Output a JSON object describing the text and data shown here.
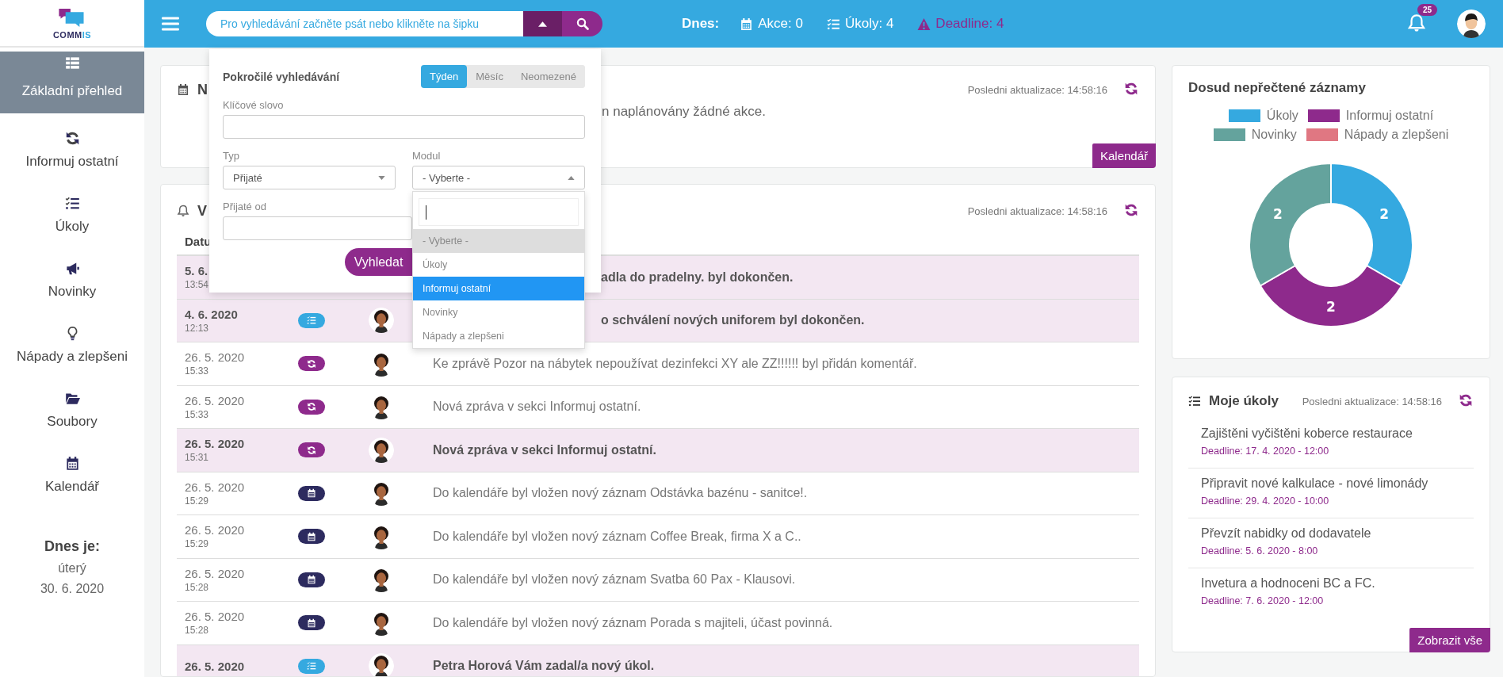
{
  "logo": {
    "main": "COMM",
    "accent": "IS"
  },
  "topbar": {
    "search_placeholder": "Pro vyhledávání začněte psát nebo klikněte na šipku",
    "today_label": "Dnes:",
    "stats": [
      {
        "kind": "events",
        "text": "Akce: 0"
      },
      {
        "kind": "tasks",
        "text": "Úkoly: 4"
      },
      {
        "kind": "deadline",
        "text": "Deadline: 4"
      }
    ],
    "notifications": "25"
  },
  "sidebar": {
    "items": [
      {
        "kind": "overview",
        "label": "Základní přehled",
        "selected": true
      },
      {
        "kind": "share",
        "label": "Informuj ostatní",
        "selected": false
      },
      {
        "kind": "tasks",
        "label": "Úkoly",
        "selected": false
      },
      {
        "kind": "news",
        "label": "Novinky",
        "selected": false
      },
      {
        "kind": "ideas",
        "label": "Nápady a zlepšeni",
        "selected": false
      },
      {
        "kind": "files",
        "label": "Soubory",
        "selected": false
      },
      {
        "kind": "calendar",
        "label": "Kalendář",
        "selected": false
      }
    ],
    "today_label": "Dnes je:",
    "weekday": "úterý",
    "date": "30. 6. 2020"
  },
  "events_card": {
    "heading": "N",
    "updated": "Posledni aktualizace: 14:58:16",
    "message": "n naplánovány žádné akce.",
    "message_covered": true,
    "button": "Kalendář"
  },
  "feed_card": {
    "heading": "V",
    "updated": "Posledni aktualizace: 14:58:16",
    "columns": [
      "Datu"
    ],
    "rows": [
      {
        "date": "5. 6.",
        "time": "13:54",
        "unread": true,
        "covered": true,
        "message": "adla do pradelny. byl dokončen."
      },
      {
        "date": "4. 6. 2020",
        "time": "12:13",
        "unread": true,
        "covered": true,
        "kind": "task",
        "has_avatar": true,
        "message": "o schválení nových uniforem byl dokončen."
      },
      {
        "date": "26. 5. 2020",
        "time": "15:33",
        "unread": false,
        "covered": false,
        "kind": "share",
        "has_avatar": true,
        "message": "Ke zprávě Pozor na nábytek nepoužívat dezinfekci XY ale ZZ!!!!!! byl přidán komentář."
      },
      {
        "date": "26. 5. 2020",
        "time": "15:33",
        "unread": false,
        "covered": false,
        "kind": "share",
        "has_avatar": true,
        "message": "Nová zpráva v sekci Informuj ostatní."
      },
      {
        "date": "26. 5. 2020",
        "time": "15:31",
        "unread": true,
        "covered": false,
        "kind": "share",
        "has_avatar": true,
        "message": "Nová zpráva v sekci Informuj ostatní."
      },
      {
        "date": "26. 5. 2020",
        "time": "15:29",
        "unread": false,
        "covered": false,
        "kind": "calendar",
        "has_avatar": true,
        "message": "Do kalendáře byl vložen nový záznam Odstávka bazénu - sanitce!."
      },
      {
        "date": "26. 5. 2020",
        "time": "15:29",
        "unread": false,
        "covered": false,
        "kind": "calendar",
        "has_avatar": true,
        "message": "Do kalendáře byl vložen nový záznam Coffee Break, firma X a C.."
      },
      {
        "date": "26. 5. 2020",
        "time": "15:28",
        "unread": false,
        "covered": false,
        "kind": "calendar",
        "has_avatar": true,
        "message": "Do kalendáře byl vložen nový záznam Svatba 60 Pax - Klausovi."
      },
      {
        "date": "26. 5. 2020",
        "time": "15:28",
        "unread": false,
        "covered": false,
        "kind": "calendar",
        "has_avatar": true,
        "message": "Do kalendáře byl vložen nový záznam Porada s majiteli, účast povinná."
      },
      {
        "date": "26. 5. 2020",
        "unread": true,
        "covered": false,
        "kind": "task",
        "has_avatar": true,
        "message": "Petra Horová Vám zadal/a nový úkol."
      }
    ]
  },
  "advanced_search": {
    "title": "Pokročilé vyhledávání",
    "periods": [
      {
        "label": "Týden",
        "selected": true
      },
      {
        "label": "Měsíc",
        "selected": false
      },
      {
        "label": "Neomezené",
        "selected": false
      }
    ],
    "keyword_label": "Klíčové slovo",
    "type_label": "Typ",
    "type_value": "Přijaté",
    "module_label": "Modul",
    "module_value": "- Vyberte -",
    "module_open": true,
    "module_options": [
      {
        "label": "- Vyberte -",
        "selected": true,
        "highlighted": false
      },
      {
        "label": "Úkoly",
        "selected": false,
        "highlighted": false
      },
      {
        "label": "Informuj ostatní",
        "selected": false,
        "highlighted": true
      },
      {
        "label": "Novinky",
        "selected": false,
        "highlighted": false
      },
      {
        "label": "Nápady a zlepšeni",
        "selected": false,
        "highlighted": false
      }
    ],
    "from_label": "Přijaté od",
    "submit": "Vyhledat"
  },
  "unread_card": {
    "chart_data": {
      "type": "donut",
      "title": "Dosud nepřečtené záznamy",
      "categories": [
        "Úkoly",
        "Informuj ostatní",
        "Novinky",
        "Nápady a zlepšeni"
      ],
      "values": [
        2,
        2,
        2,
        0
      ],
      "colors": [
        "#35a9e0",
        "#8e2a8c",
        "#64a39d",
        "#e07782"
      ],
      "data_labels": true
    }
  },
  "tasks_card": {
    "heading": "Moje úkoly",
    "updated": "Posledni aktualizace: 14:58:16",
    "tasks": [
      {
        "title": "Zajištěni vyčištěni koberce restaurace",
        "deadline": "Deadline: 17. 4. 2020 - 12:00"
      },
      {
        "title": "Připravit nové kalkulace - nové limonády",
        "deadline": "Deadline: 29. 4. 2020 - 10:00"
      },
      {
        "title": "Převzít nabidky od dodavatele",
        "deadline": "Deadline: 5. 6. 2020 - 8:00"
      },
      {
        "title": "Invetura a hodnoceni BC a FC.",
        "deadline": "Deadline: 7. 6. 2020 - 12:00"
      }
    ],
    "button": "Zobrazit vše"
  }
}
